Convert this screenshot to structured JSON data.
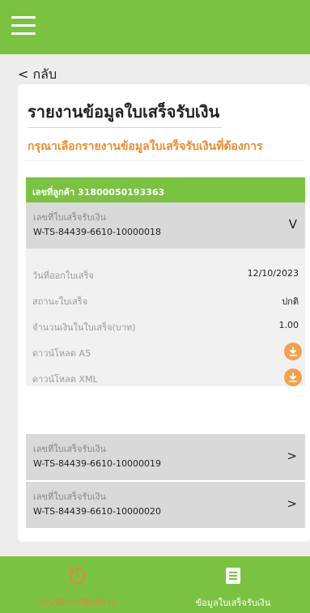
{
  "header": {
    "menu_icon": "hamburger-menu-icon"
  },
  "back_label": "< กลับ",
  "page": {
    "title": "รายงานข้อมูลใบเสร็จรับเงิน",
    "subtitle": "กรุณาเลือกรายงานข้อมูลใบเสร็จรับเงินที่ต้องการ"
  },
  "customer": {
    "label": "เลขที่ลูกค้า 31800050193363"
  },
  "receipts": [
    {
      "label": "เลขที่ใบเสร็จรับเงิน",
      "number": "W-TS-84439-6610-10000018",
      "chevron": "V",
      "expanded": true,
      "details": {
        "issue_date_label": "วันที่ออกใบเสร็จ",
        "issue_date": "12/10/2023",
        "status_label": "สถานะใบเสร็จ",
        "status": "ปกติ",
        "amount_label": "จำนวนเงินในใบเสร็จ(บาท)",
        "amount": "1.00",
        "download_a5_label": "ดาวน์โหลด A5",
        "download_xml_label": "ดาวน์โหลด XML"
      }
    },
    {
      "label": "เลขที่ใบเสร็จรับเงิน",
      "number": "W-TS-84439-6610-10000019",
      "chevron": ">",
      "expanded": false
    },
    {
      "label": "เลขที่ใบเสร็จรับเงิน",
      "number": "W-TS-84439-6610-10000020",
      "chevron": ">",
      "expanded": false
    }
  ],
  "bottom_nav": [
    {
      "label": "ประวัติการใช้บริการ",
      "icon": "history-icon",
      "active": false
    },
    {
      "label": "ข้อมูลใบเสร็จรับเงิน",
      "icon": "receipt-icon",
      "active": true
    }
  ],
  "colors": {
    "brand_green": "#7cc242",
    "accent_orange": "#f08a2e",
    "download_orange": "#f4a14e",
    "nav_inactive": "#f07d3e"
  }
}
